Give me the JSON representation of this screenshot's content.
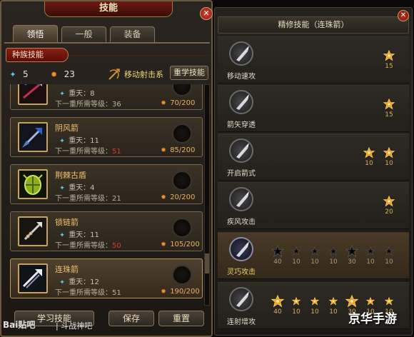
{
  "window": {
    "title": "技能",
    "close_glyph": "✕"
  },
  "tabs": [
    {
      "label": "领悟",
      "active": true
    },
    {
      "label": "一般",
      "active": false
    },
    {
      "label": "装备",
      "active": false
    }
  ],
  "race_skill_label": "种族技能",
  "points": {
    "blue": "5",
    "orange": "23"
  },
  "series_label": "移动射击系",
  "relearn_label": "重学技能",
  "skills": [
    {
      "name": "",
      "level": "重天：8",
      "req_prefix": "下一重所需等级：",
      "req_value": "36",
      "req_red": false,
      "exp": "70/200",
      "icon": "crossbow-icon"
    },
    {
      "name": "阴风箭",
      "level": "重天：11",
      "req_prefix": "下一重所需等级：",
      "req_value": "51",
      "req_red": true,
      "exp": "85/200",
      "icon": "dark-arrow-icon"
    },
    {
      "name": "荆棘古盾",
      "level": "重天：4",
      "req_prefix": "下一重所需等级：",
      "req_value": "21",
      "req_red": false,
      "exp": "20/200",
      "icon": "thorn-shield-icon"
    },
    {
      "name": "锁链箭",
      "level": "重天：11",
      "req_prefix": "下一重所需等级：",
      "req_value": "50",
      "req_red": true,
      "exp": "105/200",
      "icon": "chain-arrow-icon"
    },
    {
      "name": "连珠箭",
      "level": "重天：12",
      "req_prefix": "下一重所需等级：",
      "req_value": "51",
      "req_red": false,
      "exp": "190/200",
      "icon": "multi-arrow-icon"
    }
  ],
  "buttons": {
    "learn": "学习技能",
    "save": "保存",
    "reset": "重置"
  },
  "refine": {
    "title": "精修技能（连珠箭）",
    "close_glyph": "✕",
    "rows": [
      {
        "name": "移动速攻",
        "nodes": [
          {
            "cost": "15",
            "active": true
          }
        ]
      },
      {
        "name": "箭矢穿透",
        "nodes": [
          {
            "cost": "15",
            "active": true
          }
        ]
      },
      {
        "name": "开启箭式",
        "nodes": [
          {
            "cost": "10",
            "active": true
          },
          {
            "cost": "10",
            "active": true
          }
        ]
      },
      {
        "name": "疾风攻击",
        "nodes": [
          {
            "cost": "20",
            "active": true
          }
        ]
      },
      {
        "name": "灵巧攻击",
        "nodes": [
          {
            "cost": "40",
            "active": false
          },
          {
            "cost": "10",
            "active": false
          },
          {
            "cost": "10",
            "active": false
          },
          {
            "cost": "10",
            "active": false
          },
          {
            "cost": "30",
            "active": false
          },
          {
            "cost": "10",
            "active": false
          },
          {
            "cost": "10",
            "active": false
          }
        ]
      },
      {
        "name": "连射增攻",
        "nodes": [
          {
            "cost": "40",
            "active": true
          },
          {
            "cost": "10",
            "active": true
          },
          {
            "cost": "10",
            "active": true
          },
          {
            "cost": "10",
            "active": true
          },
          {
            "cost": "30",
            "active": true
          },
          {
            "cost": "10",
            "active": true
          },
          {
            "cost": "10",
            "active": true
          }
        ]
      }
    ]
  },
  "watermark": {
    "baidu": "Bai贴吧",
    "forum": "| 斗战神吧",
    "site": "京华手游"
  },
  "colors": {
    "accent_gold": "#c8a25a",
    "title_red": "#6a1a12",
    "active_orange": "#f0a020",
    "req_red": "#d83828"
  }
}
